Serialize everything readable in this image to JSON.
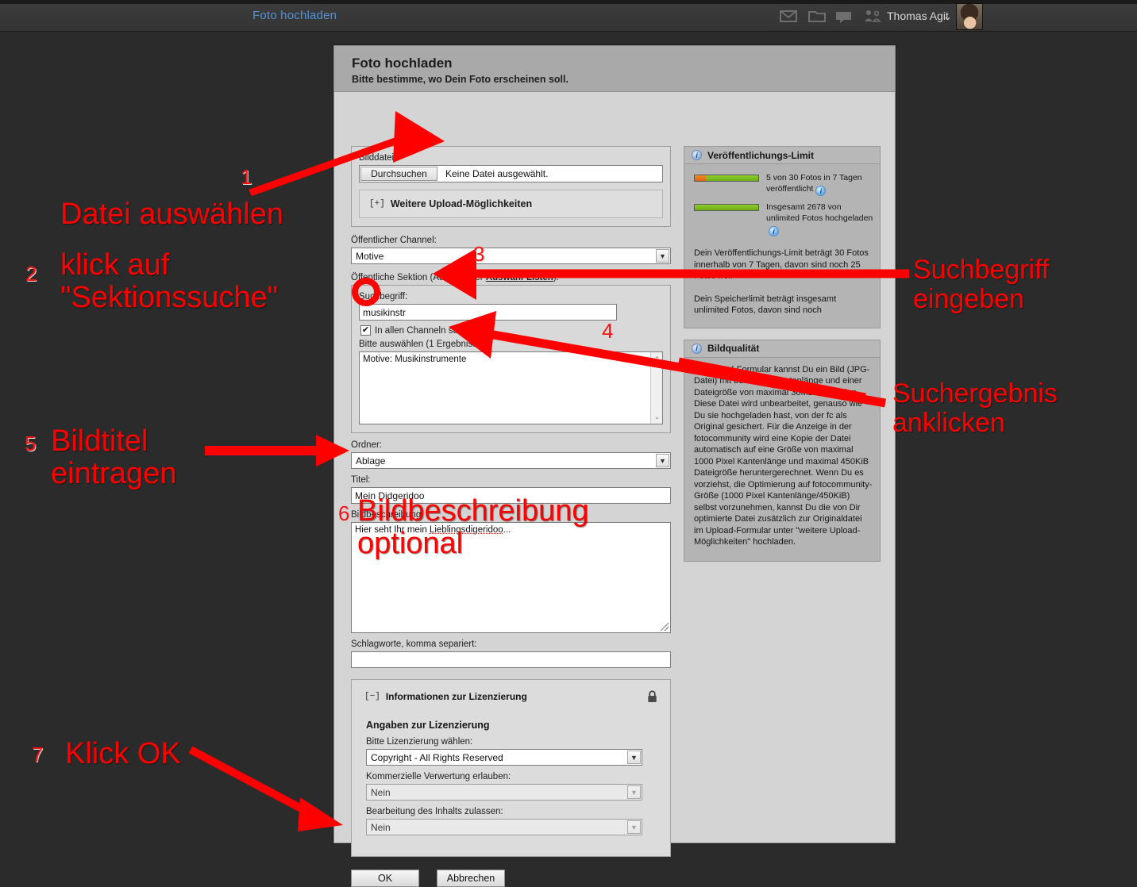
{
  "topbar": {
    "page_tab": "Foto hochladen",
    "user_name": "Thomas Agit",
    "caret": "⌄",
    "icons": [
      "mail-icon",
      "folder-icon",
      "comment-icon",
      "friends-icon"
    ],
    "avatar": "user-avatar"
  },
  "dialog": {
    "title": "Foto hochladen",
    "subtitle": "Bitte bestimme, wo Dein Foto erscheinen soll.",
    "file": {
      "label": "Bilddatei:",
      "browse_button": "Durchsuchen",
      "status": "Keine Datei ausgewählt."
    },
    "more_upload": {
      "expander": "[+]",
      "label": "Weitere Upload-Möglichkeiten"
    },
    "channel": {
      "label": "Öffentlicher Channel:",
      "value": "Motive"
    },
    "section": {
      "label_pre": "Öffentliche Sektion (Auswahl per ",
      "label_link": "Auswahl-Listen",
      "label_post": "):",
      "search_label": "Suchbegriff:",
      "search_value": "musikinstr",
      "checkbox_checked": true,
      "checkbox_mark": "✔",
      "checkbox_label": "In allen Channeln suchen",
      "results_label": "Bitte auswählen (1 Ergebnisse)",
      "results": [
        "Motive: Musikinstrumente"
      ],
      "scroll_up": "⌃",
      "scroll_down": "⌄"
    },
    "folder": {
      "label": "Ordner:",
      "value": "Ablage"
    },
    "title_field": {
      "label": "Titel:",
      "value": "Mein Didgeridoo"
    },
    "description": {
      "label": "Bildbeschreibung:",
      "value_pre": "Hier seht Ihr mein ",
      "value_underlined": "Lieblingsdigeridoo",
      "value_post": "..."
    },
    "keywords": {
      "label": "Schlagworte, komma separiert:",
      "value": ""
    },
    "license": {
      "expander": "[−]",
      "header": "Informationen zur Lizenzierung",
      "lock_icon": "lock-icon",
      "subheader": "Angaben zur Lizenzierung",
      "select_label": "Bitte Lizenzierung wählen:",
      "select_value": "Copyright - All Rights Reserved",
      "commercial_label": "Kommerzielle Verwertung erlauben:",
      "commercial_value": "Nein",
      "editing_label": "Bearbeitung des Inhalts zulassen:",
      "editing_value": "Nein"
    },
    "buttons": {
      "ok": "OK",
      "cancel": "Abbrechen"
    }
  },
  "info": {
    "limit_panel": {
      "header": "Veröffentlichungs-Limit",
      "bar1": {
        "orange_pct": 17,
        "green_pct": 83
      },
      "bar1_text": "5 von 30 Fotos in 7 Tagen veröffentlicht",
      "bar2": {
        "orange_pct": 0,
        "green_pct": 100
      },
      "bar2_text": "Insgesamt 2678 von unlimited Fotos hochgeladen",
      "para1": "Dein Veröffentlichungs-Limit beträgt 30 Fotos innerhalb von 7 Tagen, davon sind noch 25 Fotos frei.",
      "para2": "Dein Speicherlimit beträgt insgesamt unlimited Fotos, davon sind noch"
    },
    "quality_panel": {
      "header": "Bildqualität",
      "text": "Im Upload-Formular kannst Du ein Bild (JPG-Datei) mit beliebiger Kantenlänge und einer Dateigröße von maximal 30MB hochladen. Diese Datei wird unbearbeitet, genauso wie Du sie hochgeladen hast, von der fc als Original gesichert. Für die Anzeige in der fotocommunity wird eine Kopie der Datei automatisch auf eine Größe von maximal 1000 Pixel Kantenlänge und maximal 450KiB Dateigröße heruntergerechnet. Wenn Du es vorziehst, die Optimierung auf fotocommunity-Größe (1000 Pixel Kantenlänge/450KiB) selbst vorzunehmen, kannst Du die von Dir optimierte Datei zusätzlich zur Originaldatei im Upload-Formular unter \"weitere Upload-Möglichkeiten\" hochladen."
    }
  },
  "annotations": {
    "accent_color": "#ff0000",
    "steps": [
      {
        "num": "1",
        "text": "Datei auswählen"
      },
      {
        "num": "2",
        "text": "klick auf\n\"Sektionssuche\""
      },
      {
        "num": "3",
        "text": "Suchbegriff\neingeben"
      },
      {
        "num": "4",
        "text": "Suchergebnis\nanklicken"
      },
      {
        "num": "5",
        "text": "Bildtitel\neintragen"
      },
      {
        "num": "6",
        "text": "Bildbeschreibung\noptional"
      },
      {
        "num": "7",
        "text": "Klick OK"
      }
    ]
  }
}
